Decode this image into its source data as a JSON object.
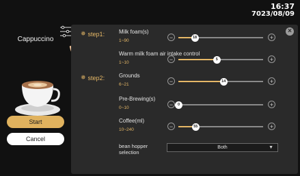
{
  "status": {
    "time": "16:37",
    "date": "7023/08/09"
  },
  "drink": {
    "name": "Cappuccino"
  },
  "buttons": {
    "start": "Start",
    "cancel": "Cancel"
  },
  "steps": {
    "step1": "step1:",
    "step2": "step2:"
  },
  "params": [
    {
      "name": "Milk foam(s)",
      "range": "1~90",
      "value": "18",
      "level": 0.19
    },
    {
      "name": "Warm milk foam air intake control",
      "range": "1~10",
      "value": "5",
      "level": 0.45
    },
    {
      "name": "Grounds",
      "range": "6~21",
      "value": "14",
      "level": 0.53
    },
    {
      "name": "Pre-Brewing(s)",
      "range": "0~10",
      "value": "0",
      "level": 0.0
    },
    {
      "name": "Coffee(ml)",
      "range": "10~240",
      "value": "55",
      "level": 0.2
    }
  ],
  "hopper": {
    "label_line1": "bean hopper",
    "label_line2": "selection",
    "selected": "Both"
  },
  "colors": {
    "accent": "#e6b867",
    "panel": "#2a2a2a",
    "background": "#111111"
  },
  "icons": [
    "menu-icon",
    "hand-icon",
    "close-icon",
    "star-icon",
    "minus-icon",
    "plus-icon",
    "chevron-down-icon",
    "cup-icon"
  ]
}
